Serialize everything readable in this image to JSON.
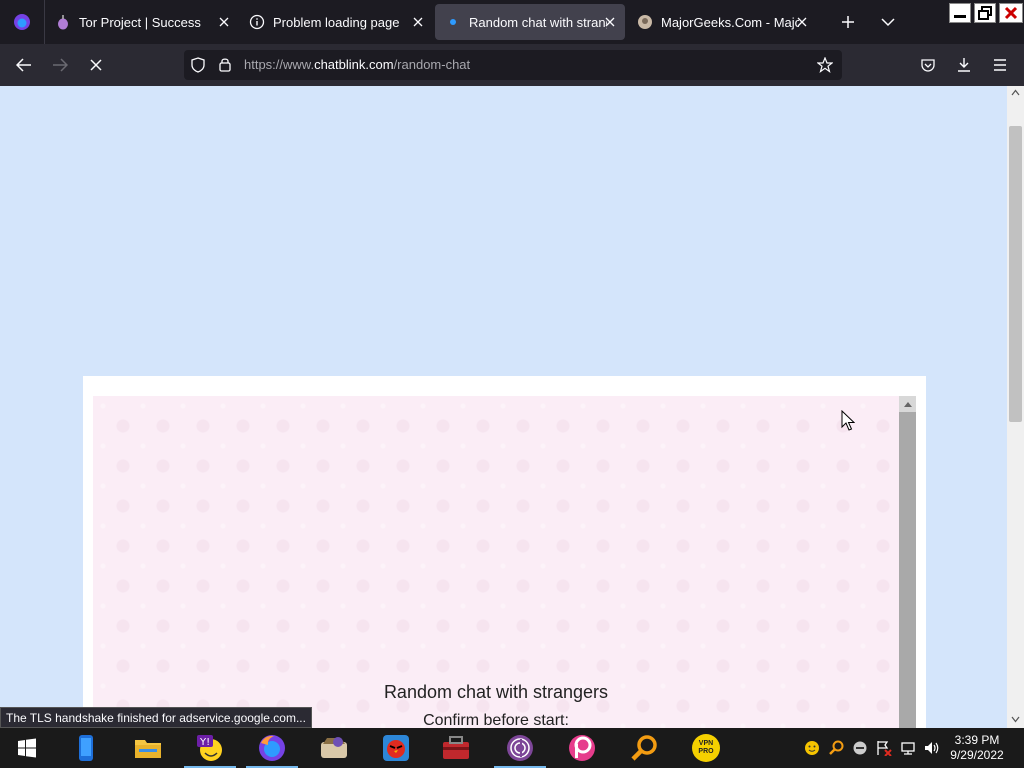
{
  "browser": {
    "tabs": [
      {
        "title": "Tor Project | Success",
        "icon": "onion-icon",
        "active": false
      },
      {
        "title": "Problem loading page",
        "icon": "info-icon",
        "active": false
      },
      {
        "title": "Random chat with strange",
        "icon": "loading-dot-icon",
        "active": true
      },
      {
        "title": "MajorGeeks.Com - MajorG",
        "icon": "majorgeeks-favicon",
        "active": false
      }
    ],
    "url_prefix": "https://www.",
    "url_domain": "chatblink.com",
    "url_path": "/random-chat",
    "status_text": "The TLS handshake finished for adservice.google.com..."
  },
  "page": {
    "chat_title": "Random chat with strangers",
    "chat_subtitle": "Confirm before start:"
  },
  "taskbar": {
    "apps": [
      "windows-start-icon",
      "phone-app-icon",
      "file-explorer-icon",
      "yahoo-messenger-icon",
      "firefox-icon",
      "script-app-icon",
      "angry-birds-icon",
      "toolbox-app-icon",
      "tor-browser-icon",
      "picsart-icon",
      "search-magnifier-icon",
      "vpn-pro-icon"
    ],
    "vpn_label": "VPN PRO",
    "clock_time": "3:39 PM",
    "clock_date": "9/29/2022"
  },
  "colors": {
    "tab_bg": "#1c1b22",
    "toolbar_bg": "#2b2a33",
    "page_bg": "#d4e5fb",
    "chat_bg": "#fbedf6",
    "taskbar_bg": "#1a1a1a"
  }
}
